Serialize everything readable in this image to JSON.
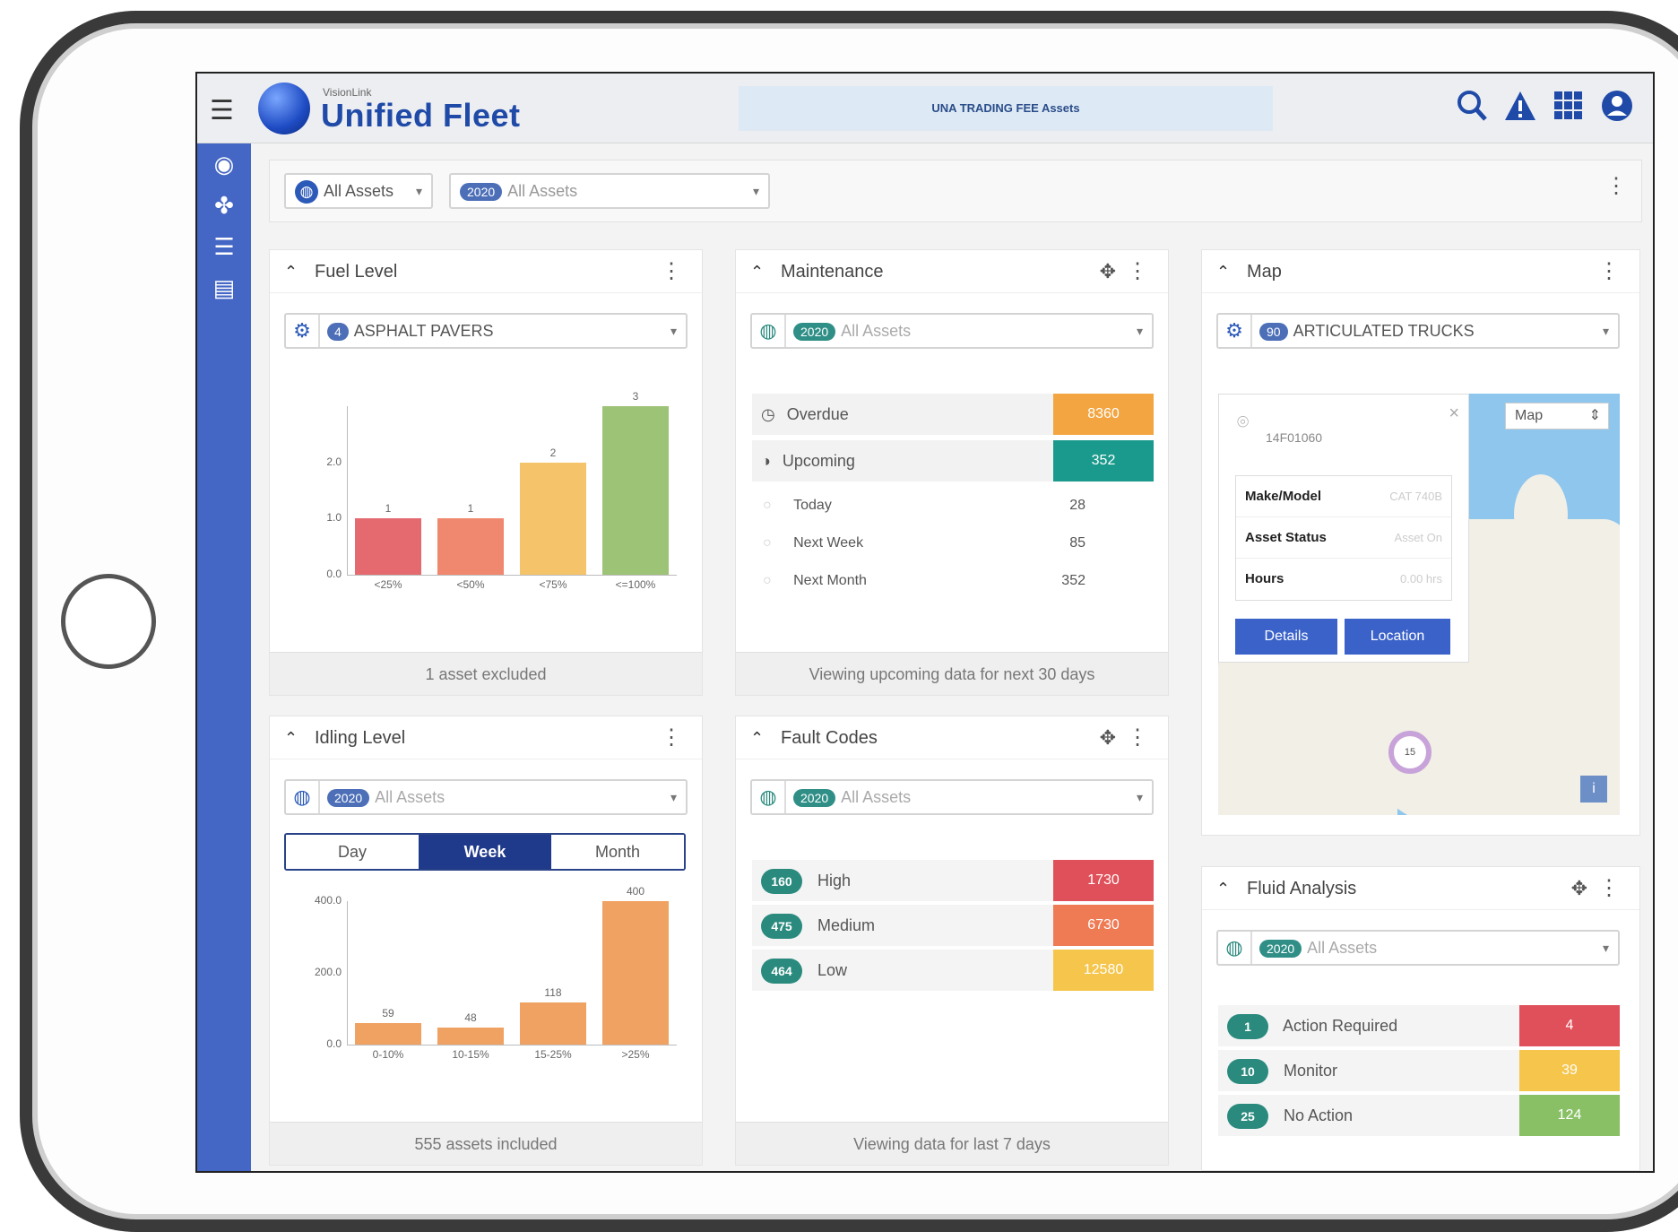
{
  "app": {
    "vendor": "VisionLink",
    "title": "Unified Fleet",
    "banner": "UNA TRADING FEE Assets"
  },
  "filters": {
    "scope": "All Assets",
    "count_badge": "2020",
    "fleet": "All Assets"
  },
  "fuel_level": {
    "title": "Fuel Level",
    "badge": "4",
    "selection": "ASPHALT PAVERS",
    "footer": "1 asset excluded",
    "chart_data": {
      "type": "bar",
      "categories": [
        "<25%",
        "<50%",
        "<75%",
        "<=100%"
      ],
      "values": [
        1,
        1,
        2,
        3
      ],
      "yticks": [
        "0.0",
        "1.0",
        "2.0"
      ],
      "ylim": [
        0,
        3
      ],
      "colors": [
        "#e46a70",
        "#f0876f",
        "#f5c46a",
        "#9dc376"
      ]
    }
  },
  "maintenance": {
    "title": "Maintenance",
    "badge": "2020",
    "selection": "All Assets",
    "rows": [
      {
        "label": "Overdue",
        "value": "8360",
        "color": "#f2a541"
      },
      {
        "label": "Upcoming",
        "value": "352",
        "color": "#1a9a8c"
      }
    ],
    "sub_rows": [
      {
        "label": "Today",
        "value": "28"
      },
      {
        "label": "Next Week",
        "value": "85"
      },
      {
        "label": "Next Month",
        "value": "352"
      }
    ],
    "footer": "Viewing upcoming data for next 30 days"
  },
  "map": {
    "title": "Map",
    "badge": "90",
    "selection": "ARTICULATED TRUCKS",
    "map_type": "Map",
    "asset_id": "14F01060",
    "fields": [
      {
        "label": "Make/Model",
        "value": "CAT 740B"
      },
      {
        "label": "Asset Status",
        "value": "Asset On"
      },
      {
        "label": "Hours",
        "value": "0.00 hrs"
      }
    ],
    "details_label": "Details",
    "location_label": "Location",
    "cluster_count": "15",
    "close_icon": "×",
    "info_icon": "i"
  },
  "idling_level": {
    "title": "Idling Level",
    "badge": "2020",
    "selection": "All Assets",
    "tabs": [
      "Day",
      "Week",
      "Month"
    ],
    "active_tab": "Week",
    "footer": "555 assets included",
    "chart_data": {
      "type": "bar",
      "categories": [
        "0-10%",
        "10-15%",
        "15-25%",
        ">25%"
      ],
      "values": [
        59,
        48,
        118,
        400
      ],
      "yticks": [
        "0.0",
        "200.0",
        "400.0"
      ],
      "ylim": [
        0,
        400
      ],
      "colors": [
        "#f0a262",
        "#f0a262",
        "#f0a262",
        "#f0a262"
      ]
    }
  },
  "fault_codes": {
    "title": "Fault Codes",
    "badge": "2020",
    "selection": "All Assets",
    "rows": [
      {
        "count": "160",
        "label": "High",
        "value": "1730",
        "color": "#e0505a"
      },
      {
        "count": "475",
        "label": "Medium",
        "value": "6730",
        "color": "#ef7b55"
      },
      {
        "count": "464",
        "label": "Low",
        "value": "12580",
        "color": "#f5c54c"
      }
    ],
    "footer": "Viewing data for last 7 days"
  },
  "fluid_analysis": {
    "title": "Fluid Analysis",
    "badge": "2020",
    "selection": "All Assets",
    "rows": [
      {
        "count": "1",
        "label": "Action Required",
        "value": "4",
        "color": "#e0505a"
      },
      {
        "count": "10",
        "label": "Monitor",
        "value": "39",
        "color": "#f5c54c"
      },
      {
        "count": "25",
        "label": "No Action",
        "value": "124",
        "color": "#89c065"
      }
    ]
  }
}
